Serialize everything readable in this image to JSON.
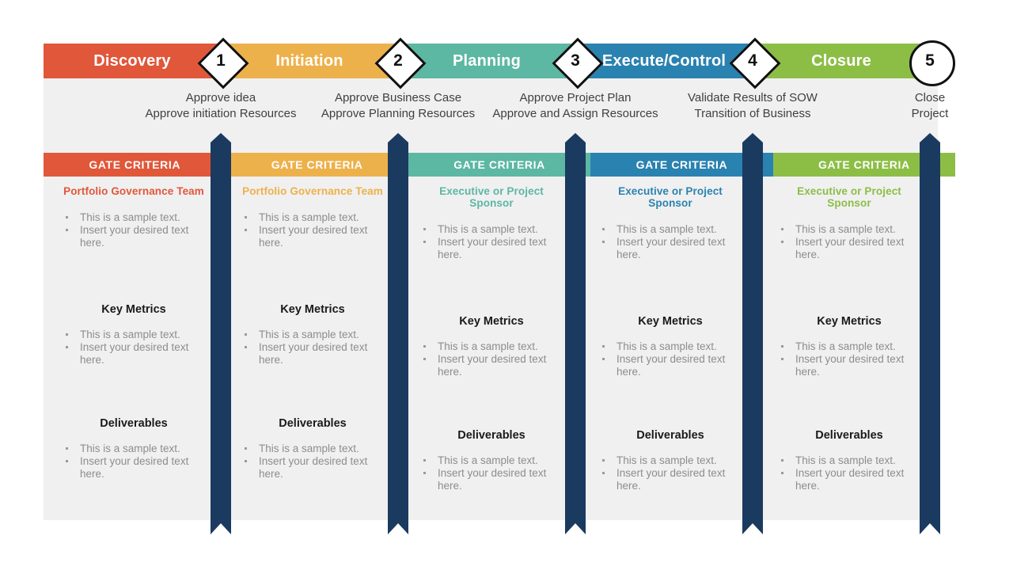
{
  "colors": {
    "discovery": "#E0573A",
    "initiation": "#EDB14B",
    "planning": "#5CB7A3",
    "execute": "#2A82B0",
    "closure": "#8CBE46",
    "ribbon": "#1b3a60",
    "panel": "#f0f0f0",
    "body_text": "#8d8d8d",
    "heading_text": "#1a1a1a"
  },
  "phases": [
    {
      "name": "Discovery",
      "color": "#E0573A"
    },
    {
      "name": "Initiation",
      "color": "#EDB14B"
    },
    {
      "name": "Planning",
      "color": "#5CB7A3"
    },
    {
      "name": "Execute/Control",
      "color": "#2A82B0"
    },
    {
      "name": "Closure",
      "color": "#8CBE46"
    }
  ],
  "gates": [
    {
      "number": "1",
      "shape": "diamond"
    },
    {
      "number": "2",
      "shape": "diamond"
    },
    {
      "number": "3",
      "shape": "diamond"
    },
    {
      "number": "4",
      "shape": "diamond"
    },
    {
      "number": "5",
      "shape": "circle"
    }
  ],
  "approvals": [
    {
      "lines": [
        "Approve idea",
        "Approve initiation Resources"
      ]
    },
    {
      "lines": [
        "Approve Business Case",
        "Approve Planning Resources"
      ]
    },
    {
      "lines": [
        "Approve Project Plan",
        "Approve and Assign Resources"
      ]
    },
    {
      "lines": [
        "Validate Results of SOW",
        "Transition of Business"
      ]
    },
    {
      "lines": [
        "Close",
        "Project"
      ]
    }
  ],
  "gate_bar_label": "GATE CRITERIA",
  "section_titles": {
    "key_metrics": "Key Metrics",
    "deliverables": "Deliverables"
  },
  "sample_bullets": [
    "This is a sample text.",
    "Insert your  desired text here."
  ],
  "columns": [
    {
      "phase": "Discovery",
      "accent": "#E0573A",
      "owner": "Portfolio Governance Team",
      "gate_bullets": [
        "This is a sample text.",
        "Insert your  desired text here."
      ],
      "metrics_bullets": [
        "This is a sample text.",
        "Insert your  desired text here."
      ],
      "deliverables_bullets": [
        "This is a sample text.",
        "Insert your  desired text here."
      ]
    },
    {
      "phase": "Initiation",
      "accent": "#EDB14B",
      "owner": "Portfolio Governance Team",
      "gate_bullets": [
        "This is a sample text.",
        "Insert your  desired text here."
      ],
      "metrics_bullets": [
        "This is a sample text.",
        "Insert your  desired text here."
      ],
      "deliverables_bullets": [
        "This is a sample text.",
        "Insert your  desired text here."
      ]
    },
    {
      "phase": "Planning",
      "accent": "#5CB7A3",
      "owner": "Executive or Project Sponsor",
      "gate_bullets": [
        "This is a sample text.",
        "Insert your  desired text here."
      ],
      "metrics_bullets": [
        "This is a sample text.",
        "Insert your  desired text here."
      ],
      "deliverables_bullets": [
        "This is a sample text.",
        "Insert your  desired text here."
      ]
    },
    {
      "phase": "Execute/Control",
      "accent": "#2A82B0",
      "owner": "Executive or Project Sponsor",
      "gate_bullets": [
        "This is a sample text.",
        "Insert your  desired text here."
      ],
      "metrics_bullets": [
        "This is a sample text.",
        "Insert your  desired text here."
      ],
      "deliverables_bullets": [
        "This is a sample text.",
        "Insert your  desired text here."
      ]
    },
    {
      "phase": "Closure",
      "accent": "#8CBE46",
      "owner": "Executive or Project Sponsor",
      "gate_bullets": [
        "This is a sample text.",
        "Insert your  desired text here."
      ],
      "metrics_bullets": [
        "This is a sample text.",
        "Insert your  desired text here."
      ],
      "deliverables_bullets": [
        "This is a sample text.",
        "Insert your  desired text here."
      ]
    }
  ]
}
